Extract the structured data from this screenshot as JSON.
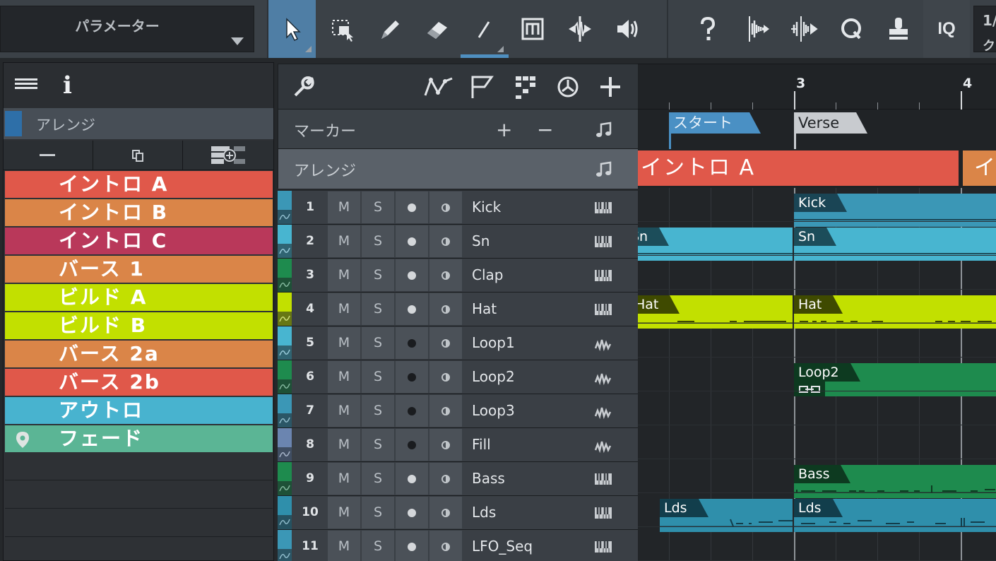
{
  "toolbar": {
    "parameter_label": "パラメーター",
    "iq_label": "IQ",
    "zoom_top": "1/",
    "zoom_bottom": "ク",
    "tools": [
      {
        "name": "arrow-tool",
        "active": true
      },
      {
        "name": "range-tool",
        "active": false
      },
      {
        "name": "paint-tool",
        "active": false
      },
      {
        "name": "eraser-tool",
        "active": false
      },
      {
        "name": "line-tool",
        "active": false
      },
      {
        "name": "mute-tool",
        "active": false
      },
      {
        "name": "split-tool",
        "active": false
      },
      {
        "name": "listen-tool",
        "active": false
      },
      {
        "name": "help-tool",
        "active": false
      },
      {
        "name": "audio-bend-tool",
        "active": false
      },
      {
        "name": "bend-markers-tool",
        "active": false
      },
      {
        "name": "quantize-tool",
        "active": false
      },
      {
        "name": "stamp-tool",
        "active": false
      }
    ]
  },
  "arranger": {
    "title": "アレンジ",
    "sections": [
      {
        "label": "イントロ A",
        "color": "#e0584a"
      },
      {
        "label": "イントロ B",
        "color": "#da8548"
      },
      {
        "label": "イントロ C",
        "color": "#b9385a"
      },
      {
        "label": "バース 1",
        "color": "#da8548"
      },
      {
        "label": "ビルド A",
        "color": "#c2e000"
      },
      {
        "label": "ビルド B",
        "color": "#c2e000"
      },
      {
        "label": "バース 2a",
        "color": "#da8548"
      },
      {
        "label": "バース 2b",
        "color": "#e0584a"
      },
      {
        "label": "アウトロ",
        "color": "#48b3cf"
      },
      {
        "label": "フェード",
        "color": "#5bb595"
      }
    ]
  },
  "header": {
    "marker_label": "マーカー",
    "arrange_label": "アレンジ",
    "marker_plus": "+",
    "marker_minus": "−"
  },
  "timeline": {
    "bars": [
      "3",
      "4"
    ],
    "markers": [
      {
        "label": "スタート",
        "color": "#4a90c4"
      },
      {
        "label": "Verse",
        "color": "#c8cbcf"
      }
    ],
    "arranger_section": "イントロ A",
    "arranger_next_fragment": "イ"
  },
  "tracks": [
    {
      "num": "1",
      "name": "Kick",
      "color": "#3b97b6",
      "type": "instrument",
      "record": true
    },
    {
      "num": "2",
      "name": "Sn",
      "color": "#48b5d0",
      "type": "instrument",
      "record": true
    },
    {
      "num": "3",
      "name": "Clap",
      "color": "#1e8b4e",
      "type": "instrument",
      "record": true
    },
    {
      "num": "4",
      "name": "Hat",
      "color": "#c2e000",
      "type": "instrument",
      "record": true
    },
    {
      "num": "5",
      "name": "Loop1",
      "color": "#48b5d0",
      "type": "audio",
      "record": false
    },
    {
      "num": "6",
      "name": "Loop2",
      "color": "#1e8b4e",
      "type": "audio",
      "record": false
    },
    {
      "num": "7",
      "name": "Loop3",
      "color": "#3b97b6",
      "type": "audio",
      "record": false
    },
    {
      "num": "8",
      "name": "Fill",
      "color": "#6b85b0",
      "type": "audio",
      "record": false
    },
    {
      "num": "9",
      "name": "Bass",
      "color": "#1e8b4e",
      "type": "instrument",
      "record": true
    },
    {
      "num": "10",
      "name": "Lds",
      "color": "#2f8fab",
      "type": "instrument",
      "record": true
    },
    {
      "num": "11",
      "name": "LFO_Seq",
      "color": "#3b97b6",
      "type": "instrument",
      "record": true
    }
  ],
  "track_buttons": {
    "mute": "M",
    "solo": "S"
  },
  "clips": {
    "kick": "Kick",
    "sn_left": "Sn",
    "sn_right": "Sn",
    "hat_left": "Hat",
    "hat_right": "Hat",
    "loop2": "Loop2",
    "bass": "Bass",
    "lds_left": "Lds",
    "lds_right": "Lds"
  }
}
